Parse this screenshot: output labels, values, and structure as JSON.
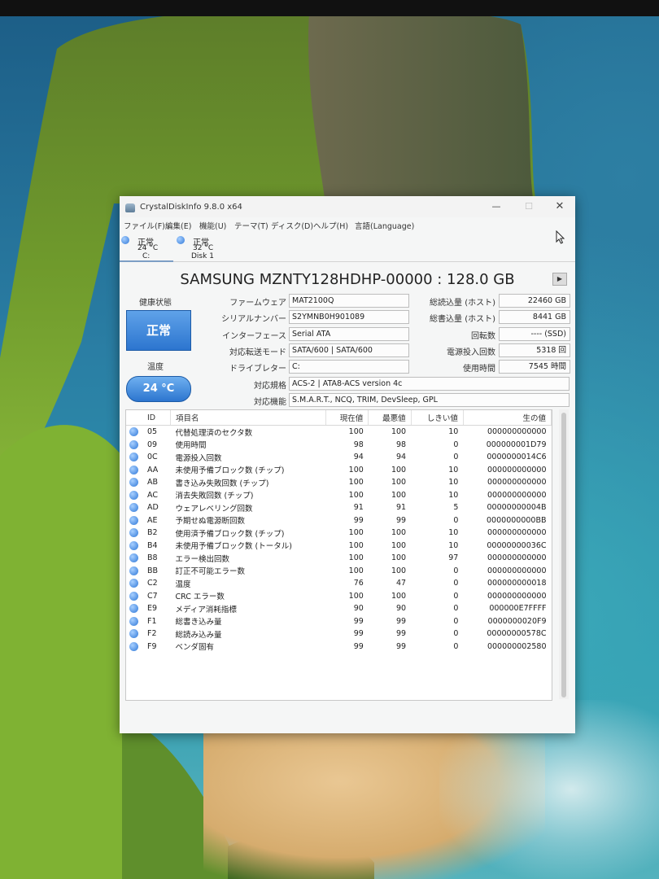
{
  "window": {
    "title": "CrystalDiskInfo 9.8.0 x64",
    "controls": {
      "minimize": "—",
      "maximize": "☐",
      "close": "✕"
    }
  },
  "menu": [
    "ファイル(F)",
    "編集(E)",
    "機能(U)",
    "テーマ(T)",
    "ディスク(D)",
    "ヘルプ(H)",
    "言語(Language)"
  ],
  "disks": [
    {
      "status": "正常",
      "temp": "24 °C",
      "label": "C:"
    },
    {
      "status": "正常",
      "temp": "32 °C",
      "label": "Disk 1"
    }
  ],
  "disk_title": "SAMSUNG MZNTY128HDHP-00000 : 128.0 GB",
  "health": {
    "label": "健康状態",
    "value": "正常",
    "color": "#2c75cf"
  },
  "temperature": {
    "label": "温度",
    "value": "24 °C"
  },
  "info": {
    "firmware": {
      "label": "ファームウェア",
      "value": "MAT2100Q"
    },
    "serial": {
      "label": "シリアルナンバー",
      "value": "S2YMNB0H901089"
    },
    "interface": {
      "label": "インターフェース",
      "value": "Serial ATA"
    },
    "transfer": {
      "label": "対応転送モード",
      "value": "SATA/600 | SATA/600"
    },
    "drive_letter": {
      "label": "ドライブレター",
      "value": "C:"
    },
    "standard": {
      "label": "対応規格",
      "value": "ACS-2 | ATA8-ACS version 4c"
    },
    "features": {
      "label": "対応機能",
      "value": "S.M.A.R.T., NCQ, TRIM, DevSleep, GPL"
    },
    "host_reads": {
      "label": "総読込量 (ホスト)",
      "value": "22460 GB"
    },
    "host_writes": {
      "label": "総書込量 (ホスト)",
      "value": "8441 GB"
    },
    "rotation": {
      "label": "回転数",
      "value": "---- (SSD)"
    },
    "power_count": {
      "label": "電源投入回数",
      "value": "5318 回"
    },
    "power_hours": {
      "label": "使用時間",
      "value": "7545 時間"
    }
  },
  "smart": {
    "headers": [
      "ID",
      "項目名",
      "現在値",
      "最悪値",
      "しきい値",
      "生の値"
    ],
    "rows": [
      [
        "05",
        "代替処理済のセクタ数",
        "100",
        "100",
        "10",
        "000000000000"
      ],
      [
        "09",
        "使用時間",
        "98",
        "98",
        "0",
        "000000001D79"
      ],
      [
        "0C",
        "電源投入回数",
        "94",
        "94",
        "0",
        "0000000014C6"
      ],
      [
        "AA",
        "未使用予備ブロック数 (チップ)",
        "100",
        "100",
        "10",
        "000000000000"
      ],
      [
        "AB",
        "書き込み失敗回数 (チップ)",
        "100",
        "100",
        "10",
        "000000000000"
      ],
      [
        "AC",
        "消去失敗回数 (チップ)",
        "100",
        "100",
        "10",
        "000000000000"
      ],
      [
        "AD",
        "ウェアレベリング回数",
        "91",
        "91",
        "5",
        "00000000004B"
      ],
      [
        "AE",
        "予期せぬ電源断回数",
        "99",
        "99",
        "0",
        "0000000000BB"
      ],
      [
        "B2",
        "使用済予備ブロック数 (チップ)",
        "100",
        "100",
        "10",
        "000000000000"
      ],
      [
        "B4",
        "未使用予備ブロック数 (トータル)",
        "100",
        "100",
        "10",
        "00000000036C"
      ],
      [
        "B8",
        "エラー検出回数",
        "100",
        "100",
        "97",
        "000000000000"
      ],
      [
        "BB",
        "訂正不可能エラー数",
        "100",
        "100",
        "0",
        "000000000000"
      ],
      [
        "C2",
        "温度",
        "76",
        "47",
        "0",
        "000000000018"
      ],
      [
        "C7",
        "CRC エラー数",
        "100",
        "100",
        "0",
        "000000000000"
      ],
      [
        "E9",
        "メディア消耗指標",
        "90",
        "90",
        "0",
        "000000E7FFFF"
      ],
      [
        "F1",
        "総書き込み量",
        "99",
        "99",
        "0",
        "0000000020F9"
      ],
      [
        "F2",
        "総読み込み量",
        "99",
        "99",
        "0",
        "00000000578C"
      ],
      [
        "F9",
        "ベンダ固有",
        "99",
        "99",
        "0",
        "000000002580"
      ]
    ]
  }
}
